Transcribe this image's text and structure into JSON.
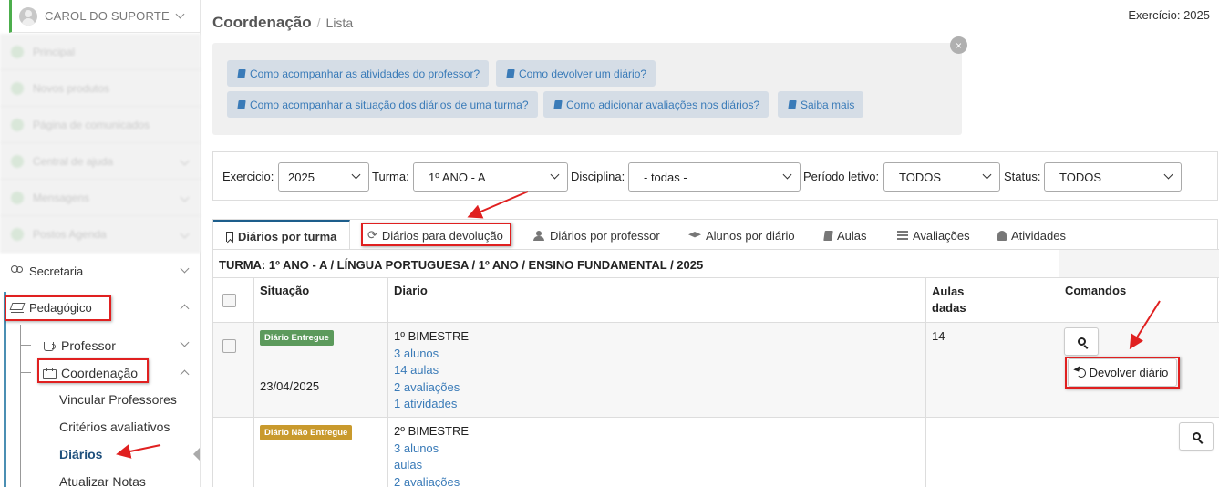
{
  "user": {
    "name": "CAROL DO SUPORTE"
  },
  "sidebar": {
    "blurred_items": [
      {
        "label": "Principal"
      },
      {
        "label": "Novos produtos"
      },
      {
        "label": "Página de comunicados"
      },
      {
        "label": "Central de ajuda"
      },
      {
        "label": "Mensagens"
      },
      {
        "label": "Postos Agenda"
      }
    ],
    "secretaria": "Secretaria",
    "pedagogico": "Pedagógico",
    "professor": "Professor",
    "coordenacao": "Coordenação",
    "sub_items": [
      "Vincular Professores",
      "Critérios avaliativos",
      "Diários",
      "Atualizar Notas"
    ]
  },
  "header": {
    "title": "Coordenação",
    "separator": "/",
    "current": "Lista",
    "exercicio": "Exercício: 2025"
  },
  "help": {
    "close": "×",
    "buttons": [
      "Como acompanhar as atividades do professor?",
      "Como devolver um diário?",
      "Como acompanhar a situação dos diários de uma turma?",
      "Como adicionar avaliações nos diários?",
      "Saiba mais"
    ]
  },
  "filters": {
    "exercicio_label": "Exercicio:",
    "exercicio_value": "2025",
    "turma_label": "Turma:",
    "turma_value": "1º ANO - A",
    "disciplina_label": "Disciplina:",
    "disciplina_value": "- todas -",
    "periodo_label": "Período letivo:",
    "periodo_value": "TODOS",
    "status_label": "Status:",
    "status_value": "TODOS"
  },
  "tabs": [
    "Diários por turma",
    "Diários para devolução",
    "Diários por professor",
    "Alunos por diário",
    "Aulas",
    "Avaliações",
    "Atividades"
  ],
  "table": {
    "turma": "TURMA: 1º ANO - A / LÍNGUA PORTUGUESA / 1º ANO / ENSINO FUNDAMENTAL / 2025",
    "headers": {
      "situacao": "Situação",
      "diario": "Diario",
      "aulas_1": "Aulas",
      "aulas_2": "dadas",
      "comandos": "Comandos"
    },
    "rows": [
      {
        "badge": "Diário Entregue",
        "date": "23/04/2025",
        "periodo": "1º BIMESTRE",
        "alunos": "3 alunos",
        "aulas": "14 aulas",
        "avaliacoes": "2 avaliações",
        "atividades": "1 atividades",
        "aulas_dadas": "14",
        "devolver": "Devolver diário"
      },
      {
        "badge": "Diário Não Entregue",
        "periodo": "2º BIMESTRE",
        "alunos": "3 alunos",
        "aulas": "aulas",
        "avaliacoes": "2 avaliações"
      }
    ]
  },
  "colors": {
    "accent": "#1d5e8c",
    "link": "#3a7bb8",
    "highlight": "#e02020",
    "badge_ok": "#5c9a5c",
    "badge_warn": "#c99a2d"
  }
}
